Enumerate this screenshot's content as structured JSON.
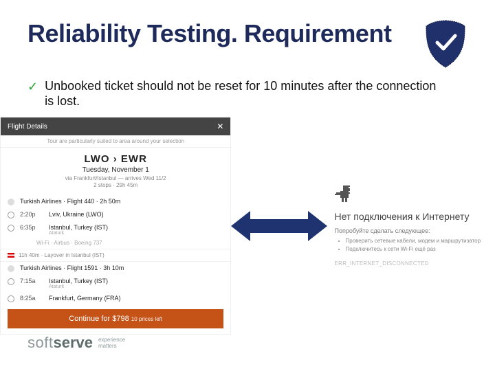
{
  "title": "Reliability Testing. Requirement",
  "bullet": "Unbooked ticket should not be reset for 10 minutes after the connection is lost.",
  "flight": {
    "header": "Flight Details",
    "close": "✕",
    "rationale": "Tour are particularly suited to area around your selection",
    "route": "LWO › EWR",
    "date": "Tuesday, November 1",
    "via": "via Frankfurt/Istanbul — arrives Wed 11/2",
    "duration": "2 stops · 29h 45m",
    "leg_airline": "Turkish Airlines · Flight 440 · 2h 50m",
    "legs": [
      {
        "time": "2:20p",
        "city": "Lviv, Ukraine (LWO)",
        "sub": ""
      },
      {
        "time": "6:35p",
        "city": "Istanbul, Turkey (IST)",
        "sub": "Ataturk"
      }
    ],
    "info": "Wi-Fi · Airbus · Boeing 737",
    "layover": "11h 40m · Layover in Istanbul (IST)",
    "leg2_airline": "Turkish Airlines · Flight 1591 · 3h 10m",
    "legs2": [
      {
        "time": "7:15a",
        "city": "Istanbul, Turkey (IST)",
        "sub": "Ataturk"
      },
      {
        "time": "8:25a",
        "city": "Frankfurt, Germany (FRA)",
        "sub": ""
      }
    ],
    "cta": "Continue for $798",
    "cta_sub": "10 prices left"
  },
  "offline": {
    "title": "Нет подключения к Интернету",
    "try": "Попробуйте сделать следующее:",
    "items": [
      "Проверить сетевые кабели, модем и маршрутизатор",
      "Подключитесь к сети Wi-Fi ещё раз"
    ],
    "code": "ERR_INTERNET_DISCONNECTED"
  },
  "footer": {
    "brand_light": "soft",
    "brand_bold": "serve",
    "tagline_l1": "experience",
    "tagline_l2": "matters"
  }
}
